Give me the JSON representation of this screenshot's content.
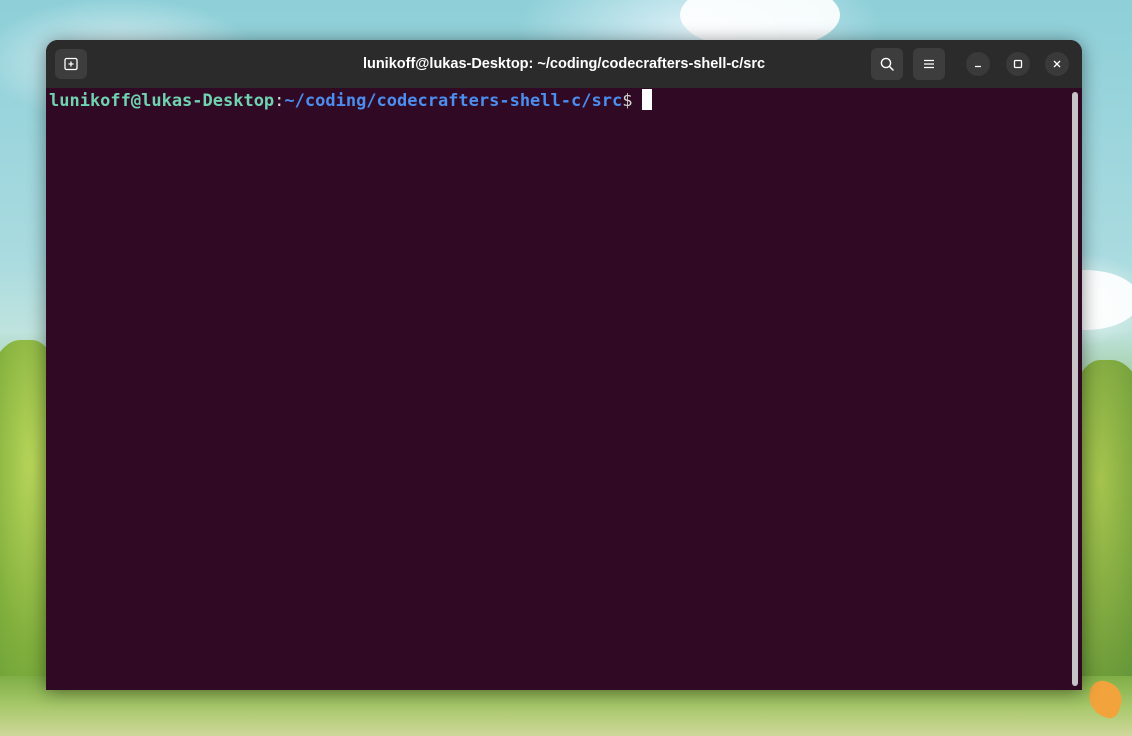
{
  "window": {
    "title": "lunikoff@lukas-Desktop: ~/coding/codecrafters-shell-c/src"
  },
  "toolbar": {
    "new_tab_icon": "new-tab-icon",
    "search_icon": "search-icon",
    "menu_icon": "hamburger-menu-icon",
    "minimize_icon": "minimize-icon",
    "maximize_icon": "maximize-icon",
    "close_icon": "close-icon"
  },
  "terminal": {
    "prompt_user": "lunikoff@lukas-Desktop",
    "prompt_separator": ":",
    "prompt_path": "~/coding/codecrafters-shell-c/src",
    "prompt_symbol": "$"
  },
  "colors": {
    "terminal_background": "#300a24",
    "titlebar_background": "#2b2b2b",
    "prompt_user": "#6fd3b0",
    "prompt_path": "#4b8ef0"
  }
}
